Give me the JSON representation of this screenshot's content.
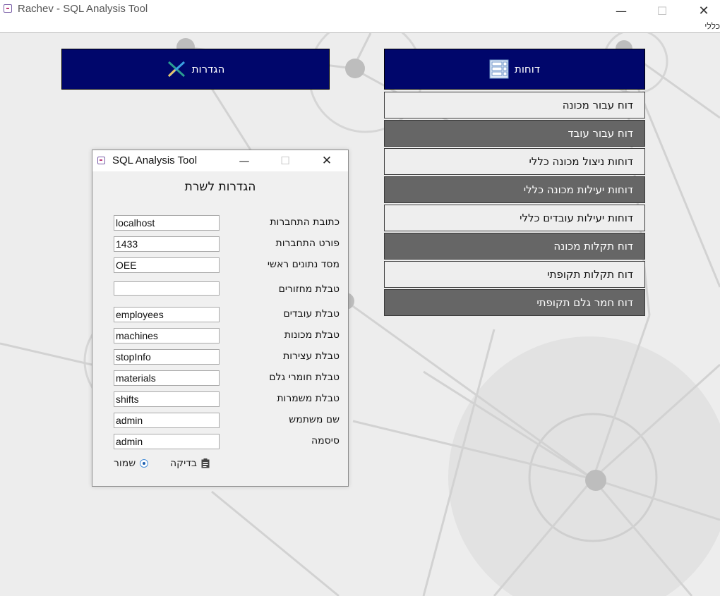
{
  "window": {
    "title": "Rachev - SQL Analysis Tool",
    "minimize_glyph": "—",
    "maximize_glyph": "☐",
    "close_glyph": "✕"
  },
  "menubar": {
    "partial_item": "כללי"
  },
  "settings_button": {
    "label": "הגדרות",
    "icon": "settings-x-icon"
  },
  "reports_button": {
    "label": "דוחות",
    "icon": "report-grid-icon"
  },
  "reports_menu": [
    {
      "label": "דוח עבור מכונה",
      "style": "light"
    },
    {
      "label": "דוח עבור עובד",
      "style": "dark"
    },
    {
      "label": "דוחות ניצול מכונה כללי",
      "style": "light"
    },
    {
      "label": "דוחות יעילות מכונה כללי",
      "style": "dark"
    },
    {
      "label": "דוחות יעילות עובדים כללי",
      "style": "light"
    },
    {
      "label": "דוח תקלות מכונה",
      "style": "dark"
    },
    {
      "label": "דוח תקלות תקופתי",
      "style": "light"
    },
    {
      "label": "דוח חמר גלם תקופתי",
      "style": "dark"
    }
  ],
  "dialog": {
    "title": "SQL Analysis Tool",
    "heading": "הגדרות לשרת",
    "fields": [
      {
        "label": "כתובת התחברות",
        "value": "localhost"
      },
      {
        "label": "פורט התחברות",
        "value": "1433"
      },
      {
        "label": "מסד נתונים ראשי",
        "value": "OEE"
      },
      {
        "label": "טבלת מחזורים",
        "value": ""
      },
      {
        "label": "טבלת עובדים",
        "value": "employees"
      },
      {
        "label": "טבלת מכונות",
        "value": "machines"
      },
      {
        "label": "טבלת עצירות",
        "value": "stopInfo"
      },
      {
        "label": "טבלת חומרי גלם",
        "value": "materials"
      },
      {
        "label": "טבלת משמרות",
        "value": "shifts"
      },
      {
        "label": "שם משתמש",
        "value": "admin"
      },
      {
        "label": "סיסמה",
        "value": "admin"
      }
    ],
    "save_label": "שמור",
    "test_label": "בדיקה"
  },
  "colors": {
    "header_blue": "#00066b",
    "menu_dark": "#666666",
    "menu_light": "#eeeeee"
  }
}
